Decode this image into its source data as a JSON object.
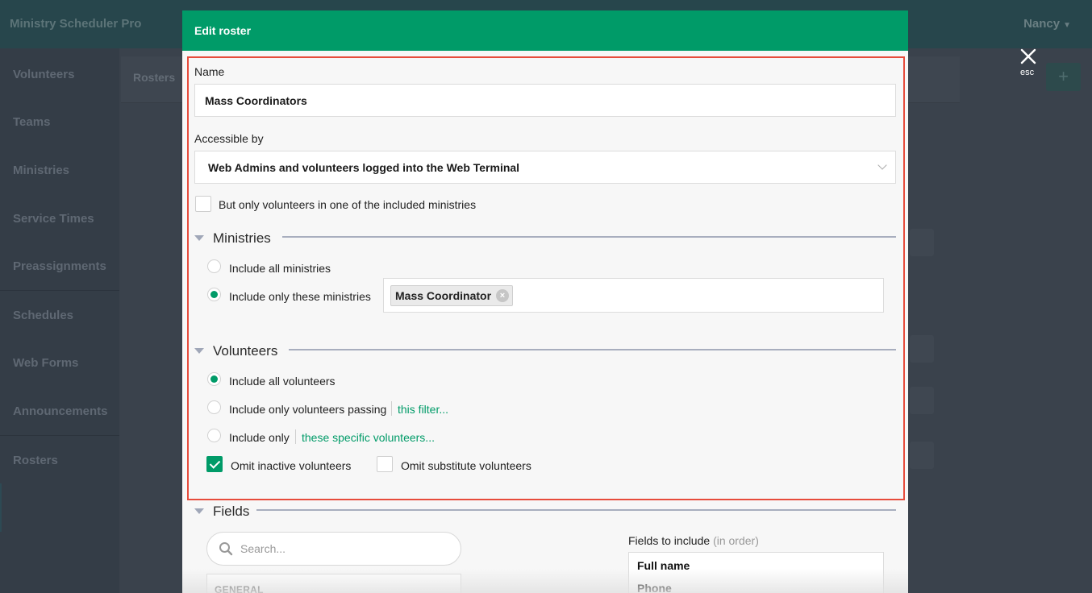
{
  "app": {
    "title": "Ministry Scheduler Pro",
    "user": "Nancy"
  },
  "sidebar": {
    "items": [
      {
        "label": "Volunteers"
      },
      {
        "label": "Teams"
      },
      {
        "label": "Ministries"
      },
      {
        "label": "Service Times"
      },
      {
        "label": "Preassignments"
      },
      {
        "label": "Schedules"
      },
      {
        "label": "Web Forms"
      },
      {
        "label": "Announcements"
      },
      {
        "label": "Rosters"
      }
    ]
  },
  "background": {
    "tab_label": "Rosters",
    "add_label": "+"
  },
  "overlay": {
    "close_label": "esc"
  },
  "modal": {
    "title": "Edit roster",
    "name": {
      "label": "Name",
      "value": "Mass Coordinators"
    },
    "accessible_by": {
      "label": "Accessible by",
      "value": "Web Admins and volunteers logged into the Web Terminal"
    },
    "only_included_ministries": {
      "label": "But only volunteers in one of the included ministries",
      "checked": false
    },
    "ministries": {
      "title": "Ministries",
      "option_all": "Include all ministries",
      "option_only": "Include only these ministries",
      "selected_option": "only",
      "tags": [
        "Mass Coordinator"
      ],
      "tag_remove": "×"
    },
    "volunteers": {
      "title": "Volunteers",
      "option_all": "Include all volunteers",
      "option_filter": "Include only volunteers passing",
      "filter_link": "this filter...",
      "option_specific": "Include only",
      "specific_link": "these specific volunteers...",
      "selected_option": "all",
      "omit_inactive": {
        "label": "Omit inactive volunteers",
        "checked": true
      },
      "omit_substitute": {
        "label": "Omit substitute volunteers",
        "checked": false
      }
    },
    "fields": {
      "title": "Fields",
      "search_placeholder": "Search...",
      "group_header": "GENERAL",
      "include_label": "Fields to include",
      "include_hint": "(in order)",
      "included": [
        "Full name",
        "Phone"
      ]
    }
  }
}
